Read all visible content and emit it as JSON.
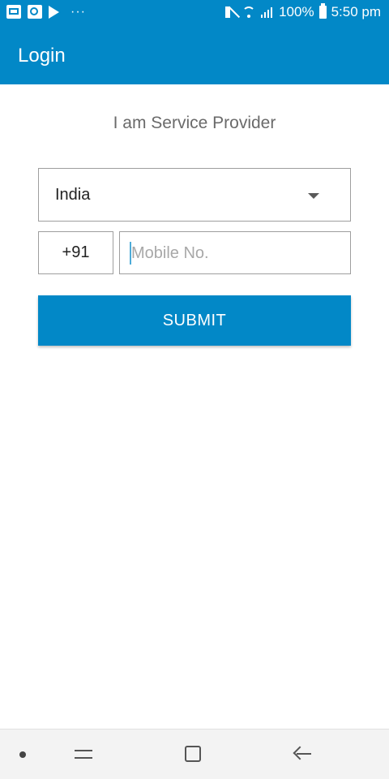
{
  "status_bar": {
    "battery": "100%",
    "time": "5:50 pm",
    "left_icons": [
      "mail-icon",
      "gallery-icon",
      "play-store-icon",
      "more-notifications-icon"
    ],
    "right_icons": [
      "mute-icon",
      "wifi-icon",
      "signal-icon",
      "battery-icon"
    ]
  },
  "app_bar": {
    "title": "Login",
    "color": "#0288c7"
  },
  "main": {
    "subtitle": "I am Service Provider",
    "country_select": {
      "selected": "India"
    },
    "country_code": "+91",
    "mobile_input": {
      "value": "",
      "placeholder": "Mobile No."
    },
    "submit_label": "SUBMIT"
  },
  "nav_bar": {
    "icons": [
      "dot-icon",
      "recent-apps-icon",
      "home-icon",
      "back-icon"
    ]
  }
}
